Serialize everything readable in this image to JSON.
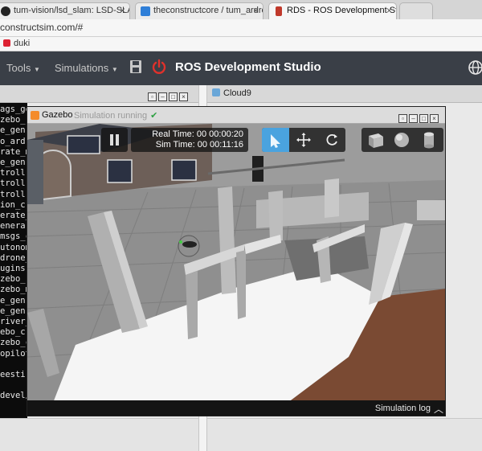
{
  "browser": {
    "tabs": [
      {
        "label": "tum-vision/lsd_slam: LSD-SLAM",
        "icon": "github-icon"
      },
      {
        "label": "theconstructcore / tum_ardrone",
        "icon": "bitbucket-icon"
      },
      {
        "label": "RDS - ROS Development Studio",
        "icon": "rds-icon"
      }
    ],
    "url": "constructsim.com/#",
    "bookmark": "duki"
  },
  "navbar": {
    "tools_label": "Tools",
    "simulations_label": "Simulations",
    "title": "ROS Development Studio",
    "accent": "#e0312b"
  },
  "ide": {
    "cloud9_tab": "Cloud9",
    "terminal_lines": [
      "ags_ge",
      "zebo_r",
      "e_gen",
      "o_ardr",
      "rate_m",
      "e_gen",
      "troll",
      "troll",
      "troll",
      "ion_c",
      "erate_",
      "enera",
      "msgs_c",
      "utonom",
      "drone_",
      "ugins",
      "zebo_r",
      "zebo_m",
      "e_gen",
      "e_gen",
      "river_",
      "ebo_c",
      "zebo_c",
      "opilot",
      "",
      "eesti",
      "",
      "devel/"
    ]
  },
  "gazebo": {
    "title": "Gazebo",
    "status": "Simulation running",
    "real_time_label": "Real Time:",
    "real_time": "00 00:00:20",
    "sim_time_label": "Sim Time:",
    "sim_time": "00 00:11:16",
    "log_label": "Simulation log",
    "tool_accent": "#4aa3df"
  }
}
